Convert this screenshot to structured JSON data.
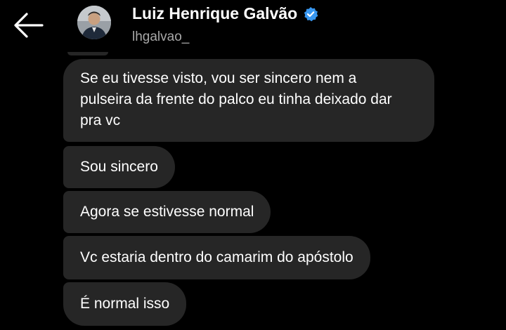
{
  "header": {
    "back_icon": "arrow-left-icon",
    "contact_name": "Luiz Henrique Galvão",
    "verified_icon": "verified-badge-icon",
    "username": "lhgalvao_",
    "avatar_icon": "profile-avatar"
  },
  "messages": [
    {
      "lines": [
        "Se eu tivesse visto, vou ser sincero nem a",
        "pulseira da frente do palco eu tinha deixado dar",
        "pra vc"
      ]
    },
    {
      "text": "Sou sincero"
    },
    {
      "text": "Agora se estivesse normal"
    },
    {
      "text": "Vc estaria dentro do camarim do apóstolo"
    },
    {
      "text": "É normal isso"
    }
  ],
  "colors": {
    "background": "#000000",
    "bubble": "#262626",
    "text": "#ffffff",
    "secondary_text": "#a8a8a8",
    "verified": "#3897f0"
  }
}
